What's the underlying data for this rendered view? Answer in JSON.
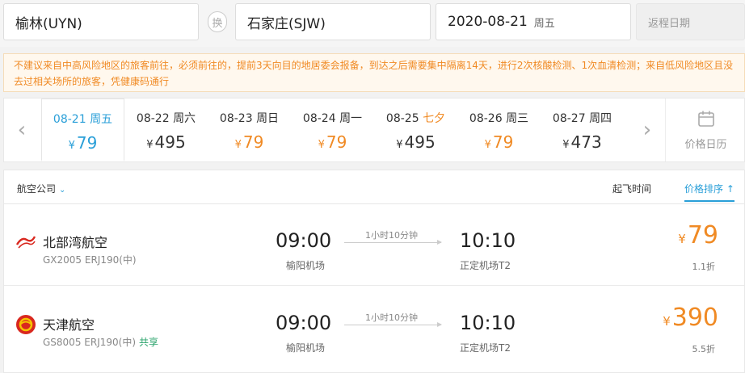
{
  "search": {
    "from": "榆林(UYN)",
    "swap_label": "换",
    "to": "石家庄(SJW)",
    "date": "2020-08-21",
    "weekday": "周五",
    "return_placeholder": "返程日期"
  },
  "notice": "不建议来自中高风险地区的旅客前往，必须前往的，提前3天向目的地居委会报备，到达之后需要集中隔离14天，进行2次核酸检测、1次血清检测；来自低风险地区且没去过相关场所的旅客，凭健康码通行",
  "dates": [
    {
      "date": "08-21",
      "label": "周五",
      "currency": "¥",
      "price": "79",
      "selected": true,
      "low": true
    },
    {
      "date": "08-22",
      "label": "周六",
      "currency": "¥",
      "price": "495",
      "selected": false,
      "low": false
    },
    {
      "date": "08-23",
      "label": "周日",
      "currency": "¥",
      "price": "79",
      "selected": false,
      "low": true
    },
    {
      "date": "08-24",
      "label": "周一",
      "currency": "¥",
      "price": "79",
      "selected": false,
      "low": true
    },
    {
      "date": "08-25",
      "label": "七夕",
      "currency": "¥",
      "price": "495",
      "selected": false,
      "low": false,
      "festival": true
    },
    {
      "date": "08-26",
      "label": "周三",
      "currency": "¥",
      "price": "79",
      "selected": false,
      "low": true
    },
    {
      "date": "08-27",
      "label": "周四",
      "currency": "¥",
      "price": "473",
      "selected": false,
      "low": false
    }
  ],
  "calendar_label": "价格日历",
  "list_header": {
    "airline_filter": "航空公司",
    "depart_sort": "起飞时间",
    "price_sort": "价格排序"
  },
  "flights": [
    {
      "airline": "北部湾航空",
      "flight_no": "GX2005 ERJ190(中)",
      "shared": "",
      "dep_time": "09:00",
      "dep_airport": "榆阳机场",
      "duration": "1小时10分钟",
      "arr_time": "10:10",
      "arr_airport": "正定机场T2",
      "currency": "¥",
      "price": "79",
      "discount": "1.1折"
    },
    {
      "airline": "天津航空",
      "flight_no": "GS8005 ERJ190(中)",
      "shared": "共享",
      "dep_time": "09:00",
      "dep_airport": "榆阳机场",
      "duration": "1小时10分钟",
      "arr_time": "10:10",
      "arr_airport": "正定机场T2",
      "currency": "¥",
      "price": "390",
      "discount": "5.5折"
    }
  ],
  "colors": {
    "accent": "#2a9fd8",
    "price": "#f08a24",
    "shared": "#2aa36b"
  }
}
